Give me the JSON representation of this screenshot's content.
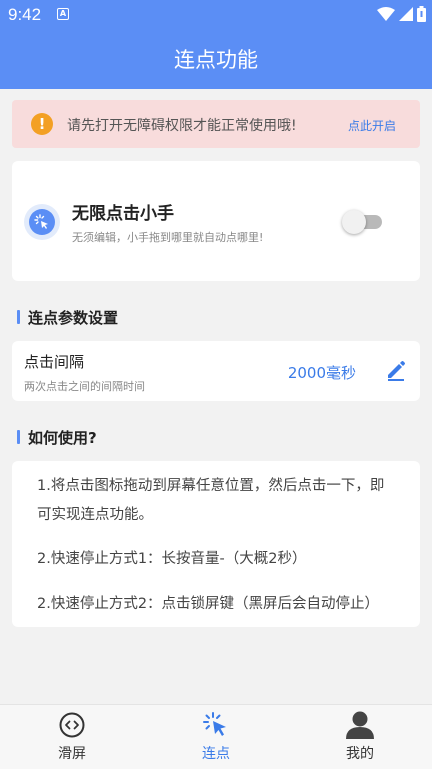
{
  "status_bar": {
    "time": "9:42",
    "notification_badge": "A"
  },
  "header": {
    "title": "连点功能"
  },
  "alert": {
    "icon": "warning-icon",
    "text": "请先打开无障碍权限才能正常使用哦!",
    "link": "点此开启"
  },
  "hand_card": {
    "title": "无限点击小手",
    "subtitle": "无须编辑，小手拖到哪里就自动点哪里!",
    "toggle_on": false
  },
  "params_section": {
    "title": "连点参数设置",
    "interval_label": "点击间隔",
    "interval_desc": "两次点击之间的间隔时间",
    "interval_value": "2000毫秒"
  },
  "howto_section": {
    "title": "如何使用?",
    "lines": [
      "1.将点击图标拖动到屏幕任意位置，然后点击一下，即",
      "可实现连点功能。",
      "2.快速停止方式1：长按音量-（大概2秒）",
      "2.快速停止方式2：点击锁屏键（黑屏后会自动停止）"
    ]
  },
  "bottom_nav": {
    "items": [
      {
        "label": "滑屏",
        "icon": "code-circle-icon",
        "active": false
      },
      {
        "label": "连点",
        "icon": "click-cursor-icon",
        "active": true
      },
      {
        "label": "我的",
        "icon": "user-icon",
        "active": false
      }
    ]
  },
  "colors": {
    "primary": "#5b8ef5",
    "alert_bg": "#f8dcdc",
    "warning": "#f3a024"
  }
}
